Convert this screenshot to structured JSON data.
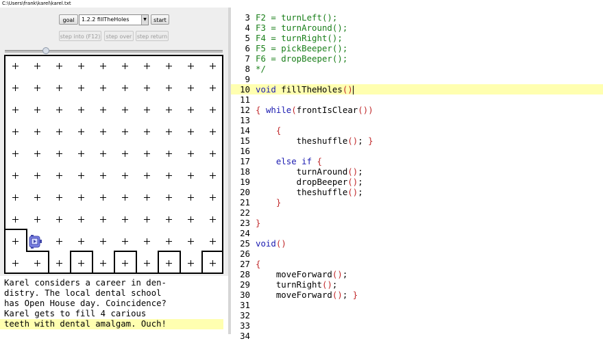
{
  "window": {
    "title": "C:\\Users\\frank\\karel\\karel.txt"
  },
  "toolbar": {
    "goal_label": "goal",
    "level_select": "1.2.2 fillTheHoles",
    "start_label": "start",
    "step_into_label": "step into (F12)",
    "step_over_label": "step over",
    "step_return_label": "step return"
  },
  "story": {
    "lines": [
      "Karel considers a career in den-",
      "distry. The local dental school",
      "has Open House day. Coincidence?",
      "Karel gets to fill 4 carious",
      "teeth with dental amalgam. Ouch!"
    ]
  },
  "editor": {
    "lines": [
      {
        "n": "3",
        "t": "F2 = turnLeft();"
      },
      {
        "n": "4",
        "t": "F3 = turnAround();"
      },
      {
        "n": "5",
        "t": "F4 = turnRight();"
      },
      {
        "n": "6",
        "t": "F5 = pickBeeper();"
      },
      {
        "n": "7",
        "t": "F6 = dropBeeper();"
      },
      {
        "n": "8",
        "t": "*/"
      },
      {
        "n": "9",
        "t": ""
      },
      {
        "n": "10",
        "t": "void fillTheHoles()"
      },
      {
        "n": "11",
        "t": ""
      },
      {
        "n": "12",
        "t": "{ while(frontIsClear())"
      },
      {
        "n": "13",
        "t": ""
      },
      {
        "n": "14",
        "t": "    {"
      },
      {
        "n": "15",
        "t": "        theshuffle(); }"
      },
      {
        "n": "16",
        "t": ""
      },
      {
        "n": "17",
        "t": "    else if {"
      },
      {
        "n": "18",
        "t": "        turnAround();"
      },
      {
        "n": "19",
        "t": "        dropBeeper();"
      },
      {
        "n": "20",
        "t": "        theshuffle();"
      },
      {
        "n": "21",
        "t": "    }"
      },
      {
        "n": "22",
        "t": ""
      },
      {
        "n": "23",
        "t": "}"
      },
      {
        "n": "24",
        "t": ""
      },
      {
        "n": "25",
        "t": "void()"
      },
      {
        "n": "26",
        "t": ""
      },
      {
        "n": "27",
        "t": "{"
      },
      {
        "n": "28",
        "t": "    moveForward();"
      },
      {
        "n": "29",
        "t": "    turnRight();"
      },
      {
        "n": "30",
        "t": "    moveForward(); }"
      },
      {
        "n": "31",
        "t": ""
      },
      {
        "n": "32",
        "t": ""
      },
      {
        "n": "33",
        "t": ""
      },
      {
        "n": "34",
        "t": ""
      }
    ]
  },
  "colors": {
    "highlight": "#ffffb0",
    "comment": "#1a7f1a",
    "keyword": "#1a1ab0",
    "brace": "#c0282a"
  }
}
